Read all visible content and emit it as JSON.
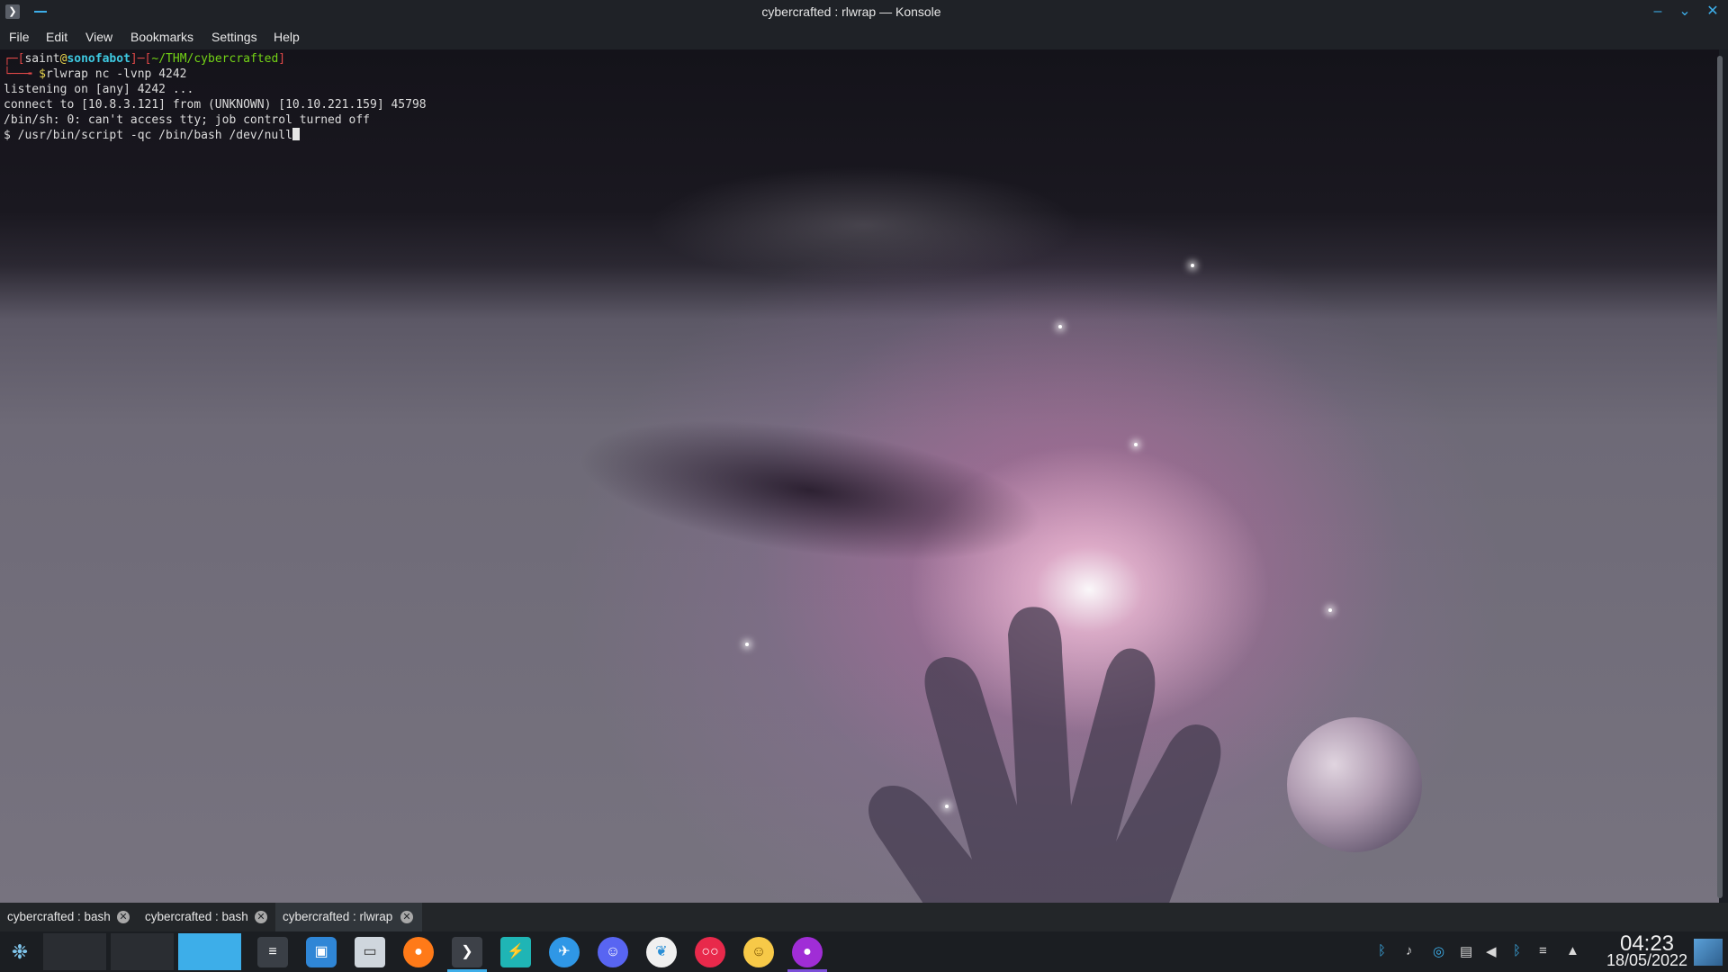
{
  "window": {
    "title": "cybercrafted : rlwrap — Konsole",
    "app_icon": "terminal-icon"
  },
  "menu": [
    "File",
    "Edit",
    "View",
    "Bookmarks",
    "Settings",
    "Help"
  ],
  "terminal": {
    "prompt": {
      "user": "saint",
      "host": "sonofabot",
      "path": "~/THM/cybercrafted",
      "command": "rlwrap nc -lvnp 4242"
    },
    "output": [
      "listening on [any] 4242 ...",
      "connect to [10.8.3.121] from (UNKNOWN) [10.10.221.159] 45798",
      "/bin/sh: 0: can't access tty; job control turned off"
    ],
    "current_input": "$ /usr/bin/script -qc /bin/bash /dev/null"
  },
  "tabs": [
    {
      "label": "cybercrafted : bash",
      "active": false
    },
    {
      "label": "cybercrafted : bash",
      "active": false
    },
    {
      "label": "cybercrafted : rlwrap",
      "active": true
    }
  ],
  "taskbar": {
    "launcher_icon": "kde-launcher-icon",
    "apps": [
      "system-settings-icon",
      "discover-store-icon",
      "file-manager-icon",
      "firefox-icon",
      "konsole-icon",
      "electron-app-icon",
      "network-app-icon",
      "discord-icon",
      "bird-app-icon",
      "flickr-icon",
      "emoji-icon",
      "firefox-dev-icon"
    ],
    "tray": [
      "bluetooth-icon",
      "notifications-icon",
      "kdeconnect-icon",
      "clipboard-icon",
      "volume-icon",
      "bluetooth-alt-icon",
      "wifi-icon",
      "expand-tray-icon"
    ],
    "clock_time": "04:23",
    "clock_date": "18/05/2022"
  },
  "colors": {
    "accent": "#3daee9",
    "prompt_red": "#e04848",
    "prompt_cyan": "#3ec8e0",
    "prompt_green": "#73d216"
  }
}
